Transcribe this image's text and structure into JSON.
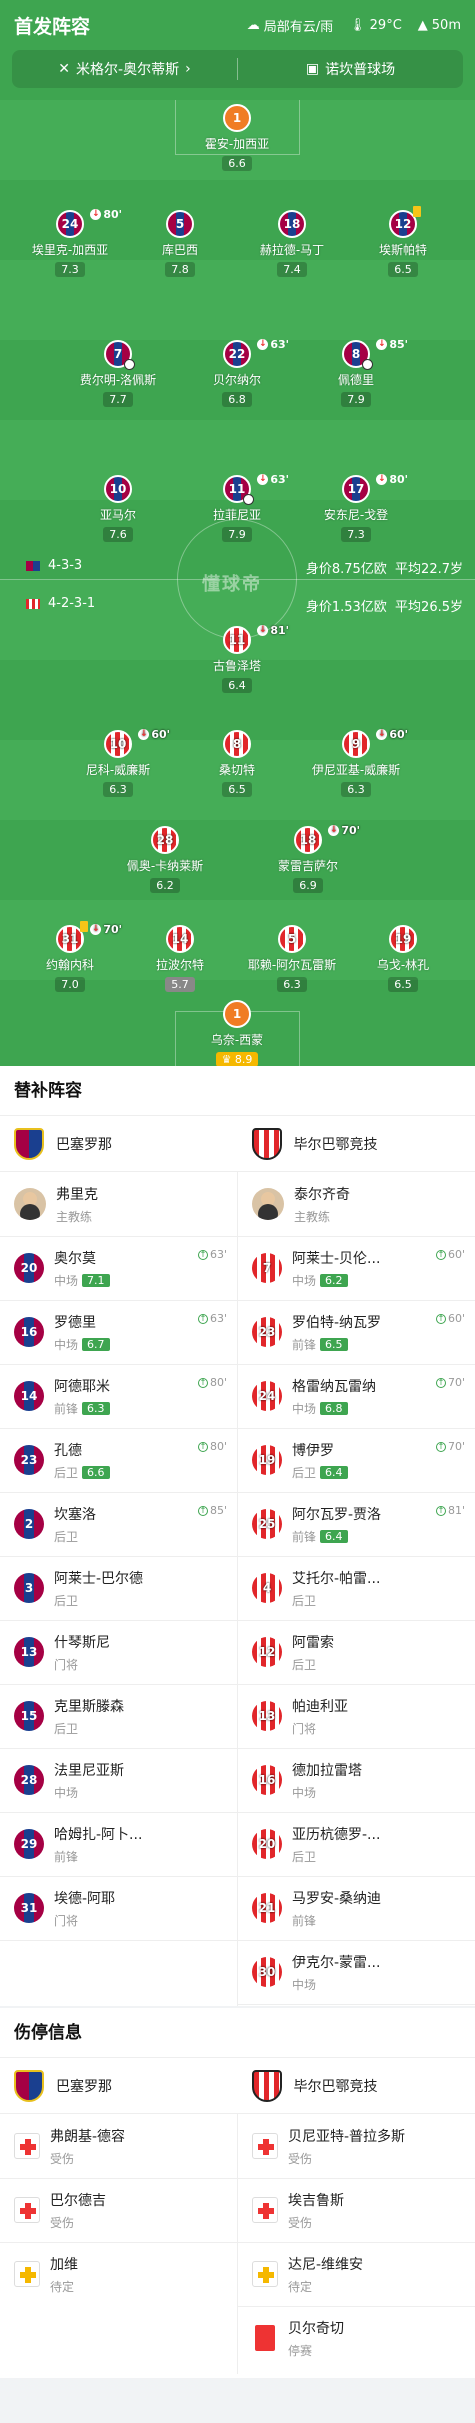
{
  "header": {
    "title": "首发阵容",
    "weather": "局部有云/雨",
    "temperature": "29°C",
    "altitude": "50m",
    "referee": "米格尔-奥尔蒂斯",
    "stadium": "诺坎普球场"
  },
  "watermark": "懂球帝",
  "home_info": {
    "formation": "4-3-3",
    "value": "身价8.75亿欧",
    "avg_age": "平均22.7岁"
  },
  "away_info": {
    "formation": "4-2-3-1",
    "value": "身价1.53亿欧",
    "avg_age": "平均26.5岁"
  },
  "home_players": [
    {
      "no": "1",
      "name": "霍安-加西亚",
      "rating": "6.6"
    },
    {
      "no": "24",
      "name": "埃里克-加西亚",
      "rating": "7.3",
      "sub": "80'"
    },
    {
      "no": "5",
      "name": "库巴西",
      "rating": "7.8"
    },
    {
      "no": "18",
      "name": "赫拉德-马丁",
      "rating": "7.4"
    },
    {
      "no": "12",
      "name": "埃斯帕特",
      "rating": "6.5"
    },
    {
      "no": "7",
      "name": "费尔明-洛佩斯",
      "rating": "7.7"
    },
    {
      "no": "22",
      "name": "贝尔纳尔",
      "rating": "6.8",
      "sub": "63'"
    },
    {
      "no": "8",
      "name": "佩德里",
      "rating": "7.9",
      "sub": "85'"
    },
    {
      "no": "10",
      "name": "亚马尔",
      "rating": "7.6"
    },
    {
      "no": "11",
      "name": "拉菲尼亚",
      "rating": "7.9",
      "sub": "63'"
    },
    {
      "no": "17",
      "name": "安东尼-戈登",
      "rating": "7.3",
      "sub": "80'"
    }
  ],
  "away_players": [
    {
      "no": "11",
      "name": "古鲁泽塔",
      "rating": "6.4",
      "sub": "81'"
    },
    {
      "no": "10",
      "name": "尼科-威廉斯",
      "rating": "6.3",
      "sub": "60'"
    },
    {
      "no": "8",
      "name": "桑切特",
      "rating": "6.5"
    },
    {
      "no": "9",
      "name": "伊尼亚基-威廉斯",
      "rating": "6.3",
      "sub": "60'"
    },
    {
      "no": "28",
      "name": "佩奥-卡纳莱斯",
      "rating": "6.2"
    },
    {
      "no": "18",
      "name": "蒙雷吉萨尔",
      "rating": "6.9",
      "sub": "70'"
    },
    {
      "no": "31",
      "name": "约翰内科",
      "rating": "7.0",
      "sub": "70'"
    },
    {
      "no": "14",
      "name": "拉波尔特",
      "rating": "5.7"
    },
    {
      "no": "5",
      "name": "耶赖-阿尔瓦雷斯",
      "rating": "6.3"
    },
    {
      "no": "19",
      "name": "乌戈-林孔",
      "rating": "6.5"
    },
    {
      "no": "1",
      "name": "乌奈-西蒙",
      "rating": "8.9"
    }
  ],
  "subs": {
    "title": "替补阵容",
    "home_team": "巴塞罗那",
    "away_team": "毕尔巴鄂竞技",
    "home_coach": {
      "name": "弗里克",
      "role": "主教练"
    },
    "away_coach": {
      "name": "泰尔齐奇",
      "role": "主教练"
    },
    "home": [
      {
        "no": "20",
        "name": "奥尔莫",
        "pos": "中场",
        "rating": "7.1",
        "min": "63'"
      },
      {
        "no": "16",
        "name": "罗德里",
        "pos": "中场",
        "rating": "6.7",
        "min": "63'"
      },
      {
        "no": "14",
        "name": "阿德耶米",
        "pos": "前锋",
        "rating": "6.3",
        "min": "80'"
      },
      {
        "no": "23",
        "name": "孔德",
        "pos": "后卫",
        "rating": "6.6",
        "min": "80'"
      },
      {
        "no": "2",
        "name": "坎塞洛",
        "pos": "后卫",
        "min": "85'"
      },
      {
        "no": "3",
        "name": "阿莱士-巴尔德",
        "pos": "后卫"
      },
      {
        "no": "13",
        "name": "什琴斯尼",
        "pos": "门将"
      },
      {
        "no": "15",
        "name": "克里斯滕森",
        "pos": "后卫"
      },
      {
        "no": "28",
        "name": "法里尼亚斯",
        "pos": "中场"
      },
      {
        "no": "29",
        "name": "哈姆扎-阿卜...",
        "pos": "前锋"
      },
      {
        "no": "31",
        "name": "埃德-阿耶",
        "pos": "门将"
      }
    ],
    "away": [
      {
        "no": "7",
        "name": "阿莱士-贝伦...",
        "pos": "中场",
        "rating": "6.2",
        "min": "60'"
      },
      {
        "no": "23",
        "name": "罗伯特-纳瓦罗",
        "pos": "前锋",
        "rating": "6.5",
        "min": "60'"
      },
      {
        "no": "24",
        "name": "格雷纳瓦雷纳",
        "pos": "中场",
        "rating": "6.8",
        "min": "70'"
      },
      {
        "no": "19",
        "name": "博伊罗",
        "pos": "后卫",
        "rating": "6.4",
        "min": "70'"
      },
      {
        "no": "25",
        "name": "阿尔瓦罗-贾洛",
        "pos": "前锋",
        "rating": "6.4",
        "min": "81'"
      },
      {
        "no": "4",
        "name": "艾托尔-帕雷...",
        "pos": "后卫"
      },
      {
        "no": "12",
        "name": "阿雷索",
        "pos": "后卫"
      },
      {
        "no": "13",
        "name": "帕迪利亚",
        "pos": "门将"
      },
      {
        "no": "16",
        "name": "德加拉雷塔",
        "pos": "中场"
      },
      {
        "no": "20",
        "name": "亚历杭德罗-...",
        "pos": "后卫"
      },
      {
        "no": "21",
        "name": "马罗安-桑纳迪",
        "pos": "前锋"
      },
      {
        "no": "30",
        "name": "伊克尔-蒙雷...",
        "pos": "中场"
      }
    ]
  },
  "injuries": {
    "title": "伤停信息",
    "home_team": "巴塞罗那",
    "away_team": "毕尔巴鄂竞技",
    "home": [
      {
        "name": "弗朗基-德容",
        "status": "受伤"
      },
      {
        "name": "巴尔德吉",
        "status": "受伤"
      },
      {
        "name": "加维",
        "status": "待定"
      }
    ],
    "away": [
      {
        "name": "贝尼亚特-普拉多斯",
        "status": "受伤"
      },
      {
        "name": "埃吉鲁斯",
        "status": "受伤"
      },
      {
        "name": "达尼-维维安",
        "status": "待定"
      },
      {
        "name": "贝尔奇切",
        "status": "停赛"
      }
    ]
  }
}
